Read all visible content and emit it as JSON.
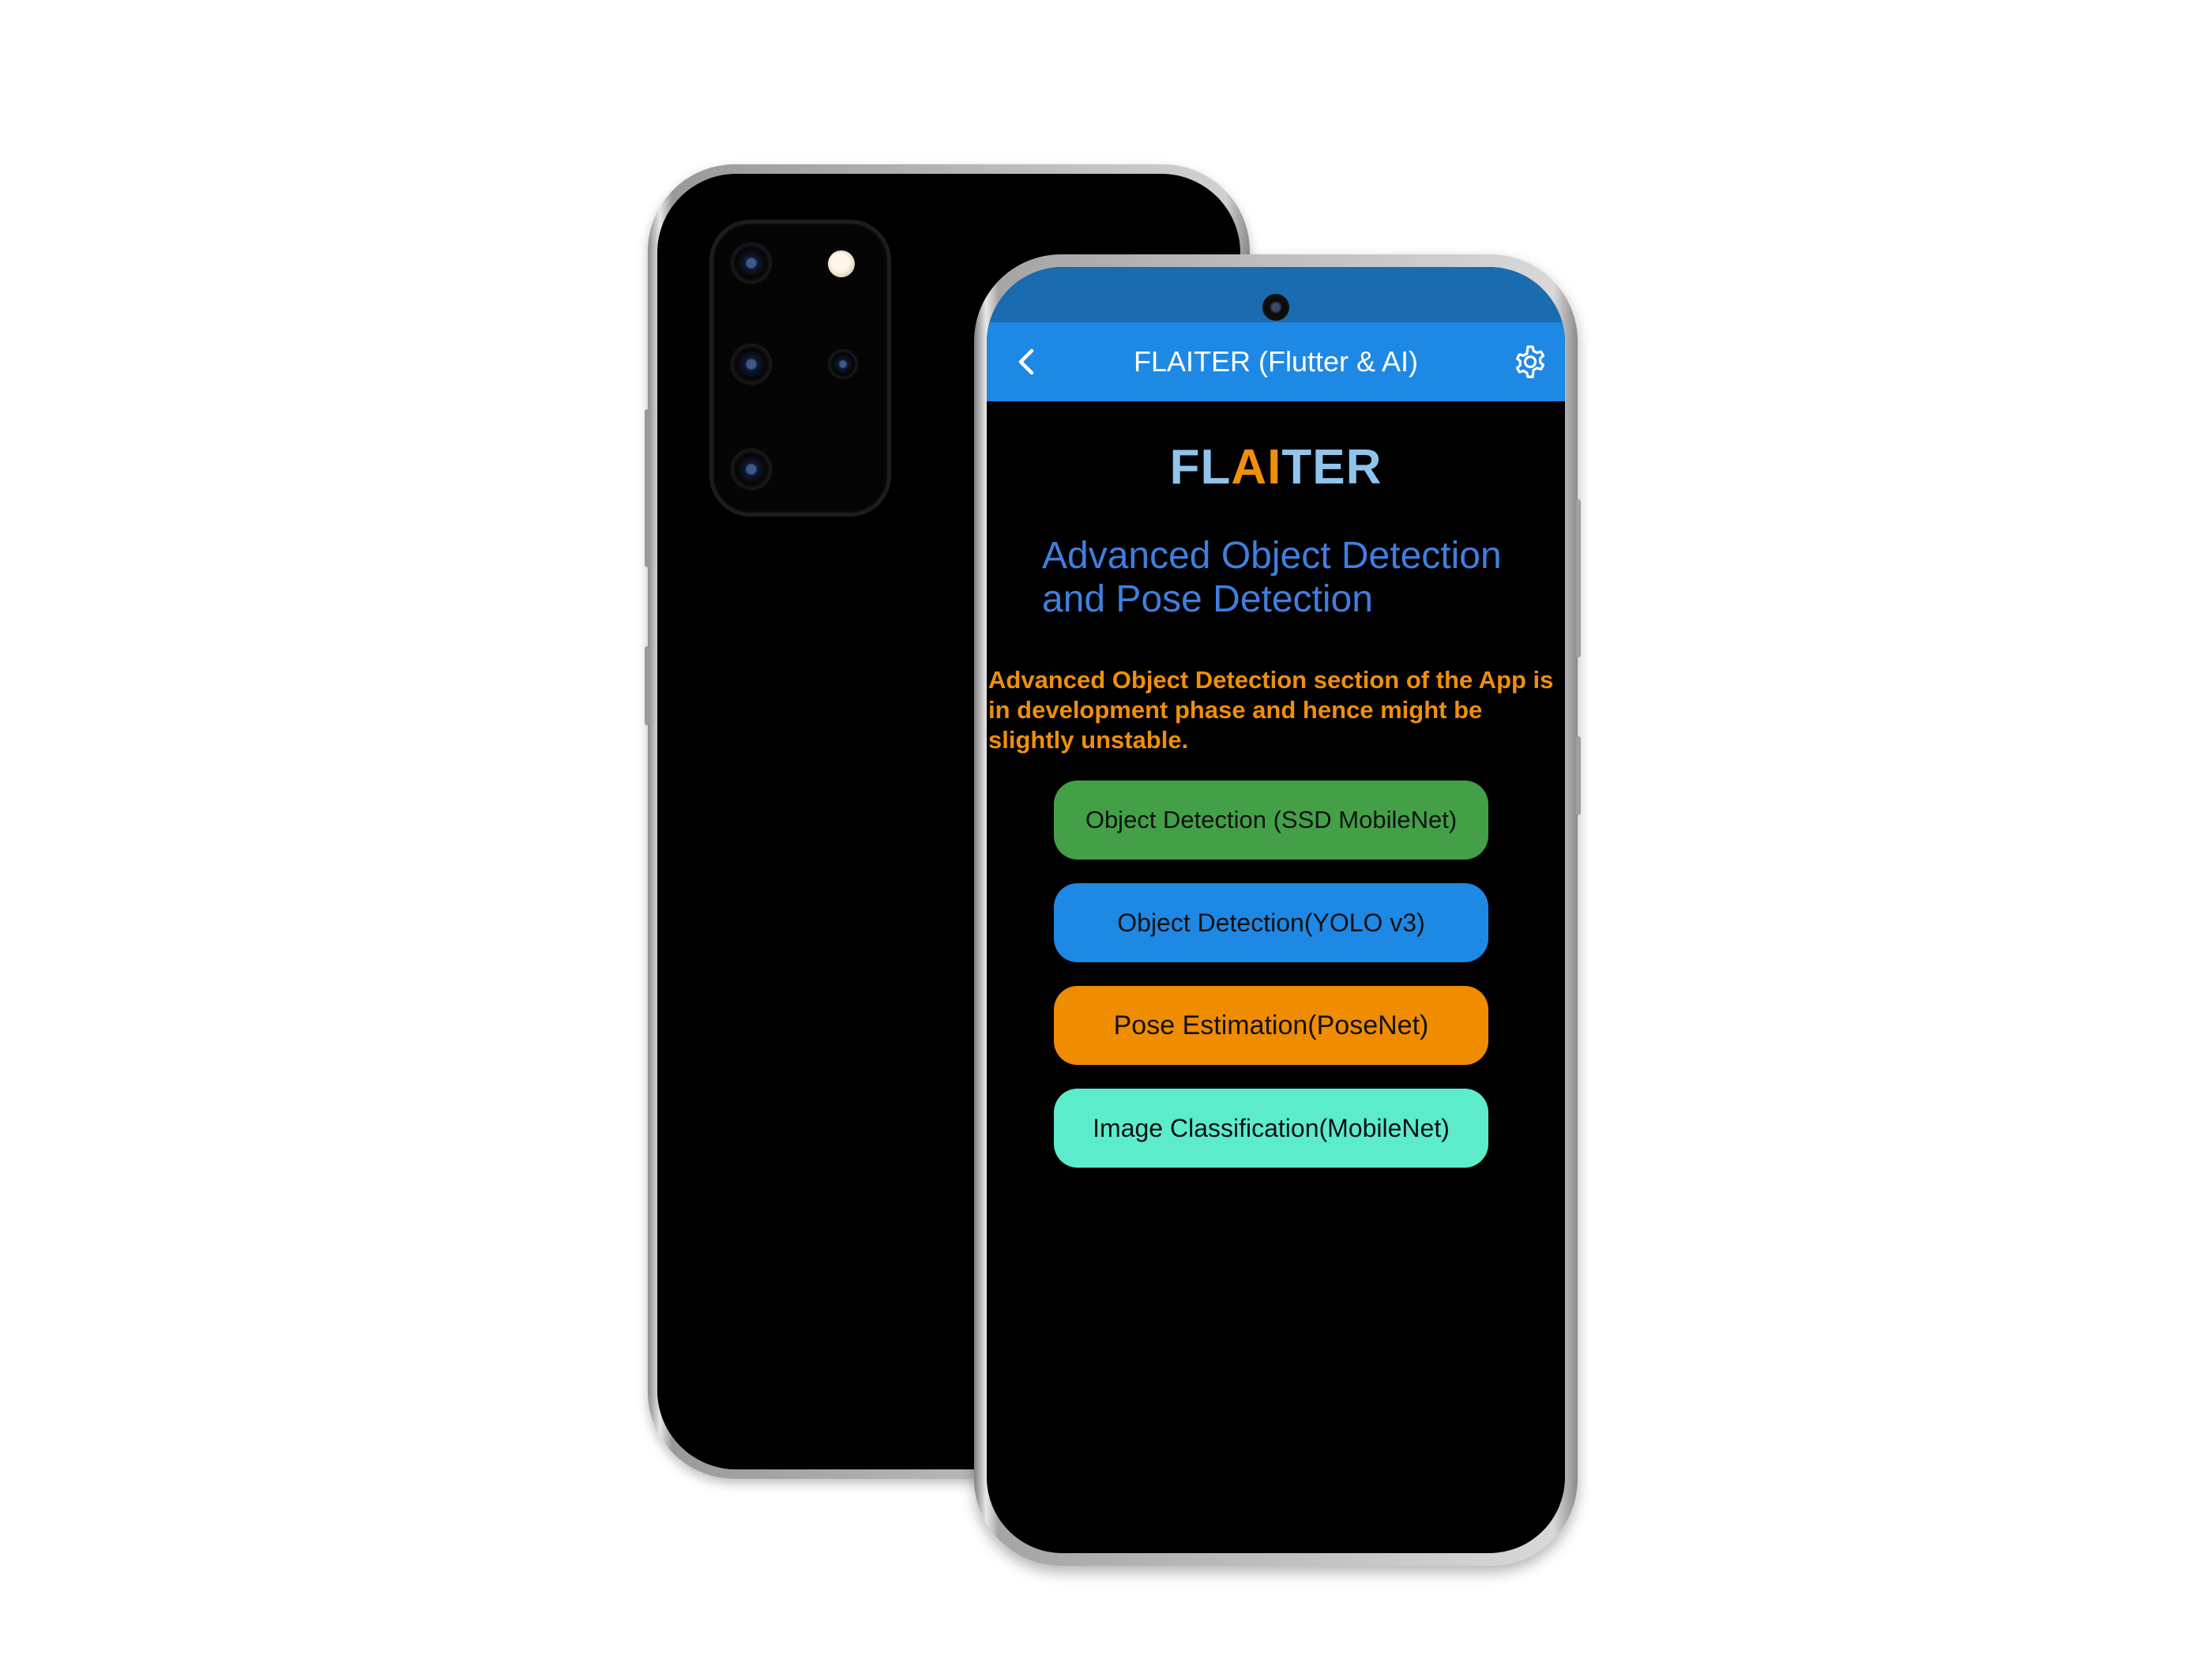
{
  "app_bar": {
    "title": "FLAITER (Flutter & AI)",
    "back_icon": "chevron-left-icon",
    "settings_icon": "gear-icon"
  },
  "logo": {
    "part_a": "FL",
    "part_b": "AI",
    "part_c": "TER"
  },
  "subtitle_line1": "Advanced Object Detection",
  "subtitle_line2": "and Pose Detection",
  "notice_text": "Advanced Object Detection section of the App is in development phase and hence might be slightly unstable.",
  "buttons": [
    {
      "label": "Object Detection (SSD MobileNet)",
      "color": "#43a047"
    },
    {
      "label": "Object Detection(YOLO v3)",
      "color": "#1e88e5"
    },
    {
      "label": "Pose Estimation(PoseNet)",
      "color": "#ef8c00"
    },
    {
      "label": "Image Classification(MobileNet)",
      "color": "#5ceccc"
    }
  ],
  "colors": {
    "app_bar": "#1e88e5",
    "status_bar": "#1a6bb0",
    "screen_background": "#000000",
    "logo_light": "#90c4ec",
    "logo_accent": "#ef8f0a",
    "subtitle": "#3f7fe0",
    "notice": "#ef8f0a"
  }
}
